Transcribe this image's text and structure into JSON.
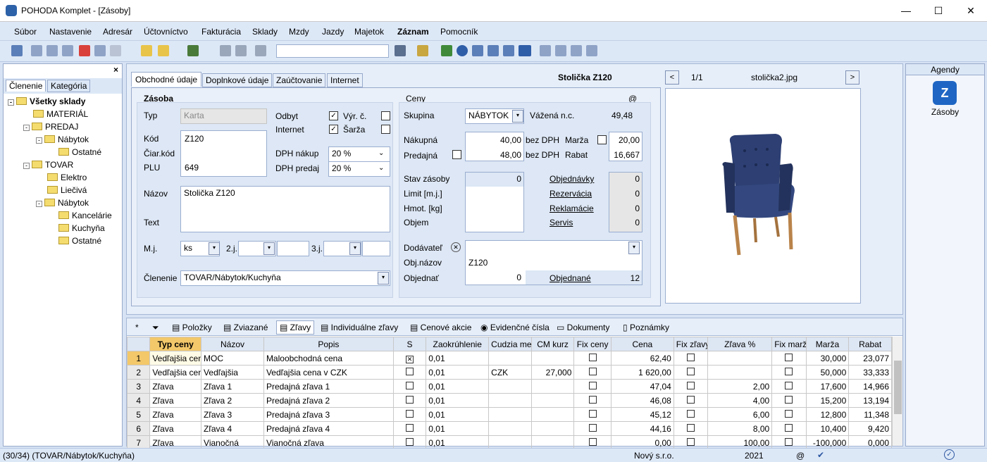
{
  "title": "POHODA Komplet - [Zásoby]",
  "menu": [
    "Súbor",
    "Nastavenie",
    "Adresár",
    "Účtovníctvo",
    "Fakturácia",
    "Sklady",
    "Mzdy",
    "Jazdy",
    "Majetok",
    "Záznam",
    "Pomocník"
  ],
  "left_tabs": [
    "Členenie",
    "Kategória"
  ],
  "tree": [
    "Všetky sklady",
    "MATERIÁL",
    "PREDAJ",
    "Nábytok",
    "Ostatné",
    "TOVAR",
    "Elektro",
    "Liečivá",
    "Nábytok",
    "Kancelárie",
    "Kuchyňa",
    "Ostatné"
  ],
  "main_tabs": [
    "Obchodné údaje",
    "Doplnkové údaje",
    "Zaúčtovanie",
    "Internet"
  ],
  "record_title": "Stolička Z120",
  "image_nav": {
    "pos": "1/1",
    "file": "stolička2.jpg",
    "prev": "<",
    "next": ">"
  },
  "zasoba": {
    "section": "Zásoba",
    "typ_label": "Typ",
    "typ": "Karta",
    "odbyt": "Odbyt",
    "vyr": "Výr. č.",
    "internet": "Internet",
    "sarza": "Šarža",
    "kod_label": "Kód",
    "kod": "Z120",
    "ciar_label": "Čiar.kód",
    "plu_label": "PLU",
    "plu": "649",
    "dph_nakup_label": "DPH nákup",
    "dph_nakup": "20 %",
    "dph_predaj_label": "DPH predaj",
    "dph_predaj": "20 %",
    "nazov_label": "Názov",
    "nazov": "Stolička Z120",
    "text_label": "Text",
    "mj_label": "M.j.",
    "mj": "ks",
    "j2_label": "2.j.",
    "j3_label": "3.j.",
    "clenenie_label": "Členenie",
    "clenenie": "TOVAR/Nábytok/Kuchyňa"
  },
  "ceny": {
    "section": "Ceny",
    "at": "@",
    "skupina_label": "Skupina",
    "skupina": "NÁBYTOK",
    "vazena_label": "Vážená n.c.",
    "vazena": "49,48",
    "nakupna_label": "Nákupná",
    "nakupna": "40,00",
    "bez_dph": "bez DPH",
    "marza_label": "Marža",
    "marza": "20,00",
    "predajna_label": "Predajná",
    "predajna": "48,00",
    "rabat_label": "Rabat",
    "rabat": "16,667",
    "stav_label": "Stav zásoby",
    "stav": "0",
    "limit_label": "Limit [m.j.]",
    "hmot_label": "Hmot. [kg]",
    "objem_label": "Objem",
    "objednavky": "Objednávky",
    "objednavky_v": "0",
    "rezervacia": "Rezervácia",
    "rezervacia_v": "0",
    "reklamacie": "Reklamácie",
    "reklamacie_v": "0",
    "servis": "Servis",
    "servis_v": "0",
    "dodavatel_label": "Dodávateľ",
    "objnazov_label": "Obj.názov",
    "objnazov": "Z120",
    "objednat_label": "Objednať",
    "objednat": "0",
    "objednane": "Objednané",
    "objednane_v": "12"
  },
  "bottom_tabs": [
    "*",
    "Položky",
    "Zviazané",
    "Zľavy",
    "Individuálne zľavy",
    "Cenové akcie",
    "Evidenčné čísla",
    "Dokumenty",
    "Poznámky"
  ],
  "grid": {
    "headers": [
      "Typ ceny",
      "Názov",
      "Popis",
      "S",
      "Zaokrúhlenie",
      "Cudzia mer",
      "CM kurz",
      "Fix ceny",
      "Cena",
      "Fix zľavy",
      "Zľava %",
      "Fix marže",
      "Marža",
      "Rabat"
    ],
    "rows": [
      [
        "1",
        "Vedľajšia cen",
        "MOC",
        "Maloobchodná cena",
        "x",
        "0,01",
        "",
        "",
        "",
        "62,40",
        "",
        "",
        "",
        "30,000",
        "23,077"
      ],
      [
        "2",
        "Vedľajšia cen",
        "Vedľajšia",
        "Vedľajšia cena v CZK",
        "",
        "0,01",
        "CZK",
        "27,000",
        "",
        "1 620,00",
        "",
        "",
        "",
        "50,000",
        "33,333"
      ],
      [
        "3",
        "Zľava",
        "Zľava 1",
        "Predajná zľava 1",
        "",
        "0,01",
        "",
        "",
        "",
        "47,04",
        "",
        "2,00",
        "",
        "17,600",
        "14,966"
      ],
      [
        "4",
        "Zľava",
        "Zľava 2",
        "Predajná zľava 2",
        "",
        "0,01",
        "",
        "",
        "",
        "46,08",
        "",
        "4,00",
        "",
        "15,200",
        "13,194"
      ],
      [
        "5",
        "Zľava",
        "Zľava 3",
        "Predajná zľava 3",
        "",
        "0,01",
        "",
        "",
        "",
        "45,12",
        "",
        "6,00",
        "",
        "12,800",
        "11,348"
      ],
      [
        "6",
        "Zľava",
        "Zľava 4",
        "Predajná zľava 4",
        "",
        "0,01",
        "",
        "",
        "",
        "44,16",
        "",
        "8,00",
        "",
        "10,400",
        "9,420"
      ],
      [
        "7",
        "Zľava",
        "Vianočná",
        "Vianočná zľava",
        "",
        "0,01",
        "",
        "",
        "",
        "0,00",
        "",
        "100,00",
        "",
        "-100,000",
        "0,000"
      ]
    ]
  },
  "agendy": {
    "title": "Agendy",
    "item": "Zásoby"
  },
  "status": {
    "left": "(30/34) (TOVAR/Nábytok/Kuchyňa)",
    "company": "Nový s.r.o.",
    "year": "2021",
    "at": "@"
  }
}
